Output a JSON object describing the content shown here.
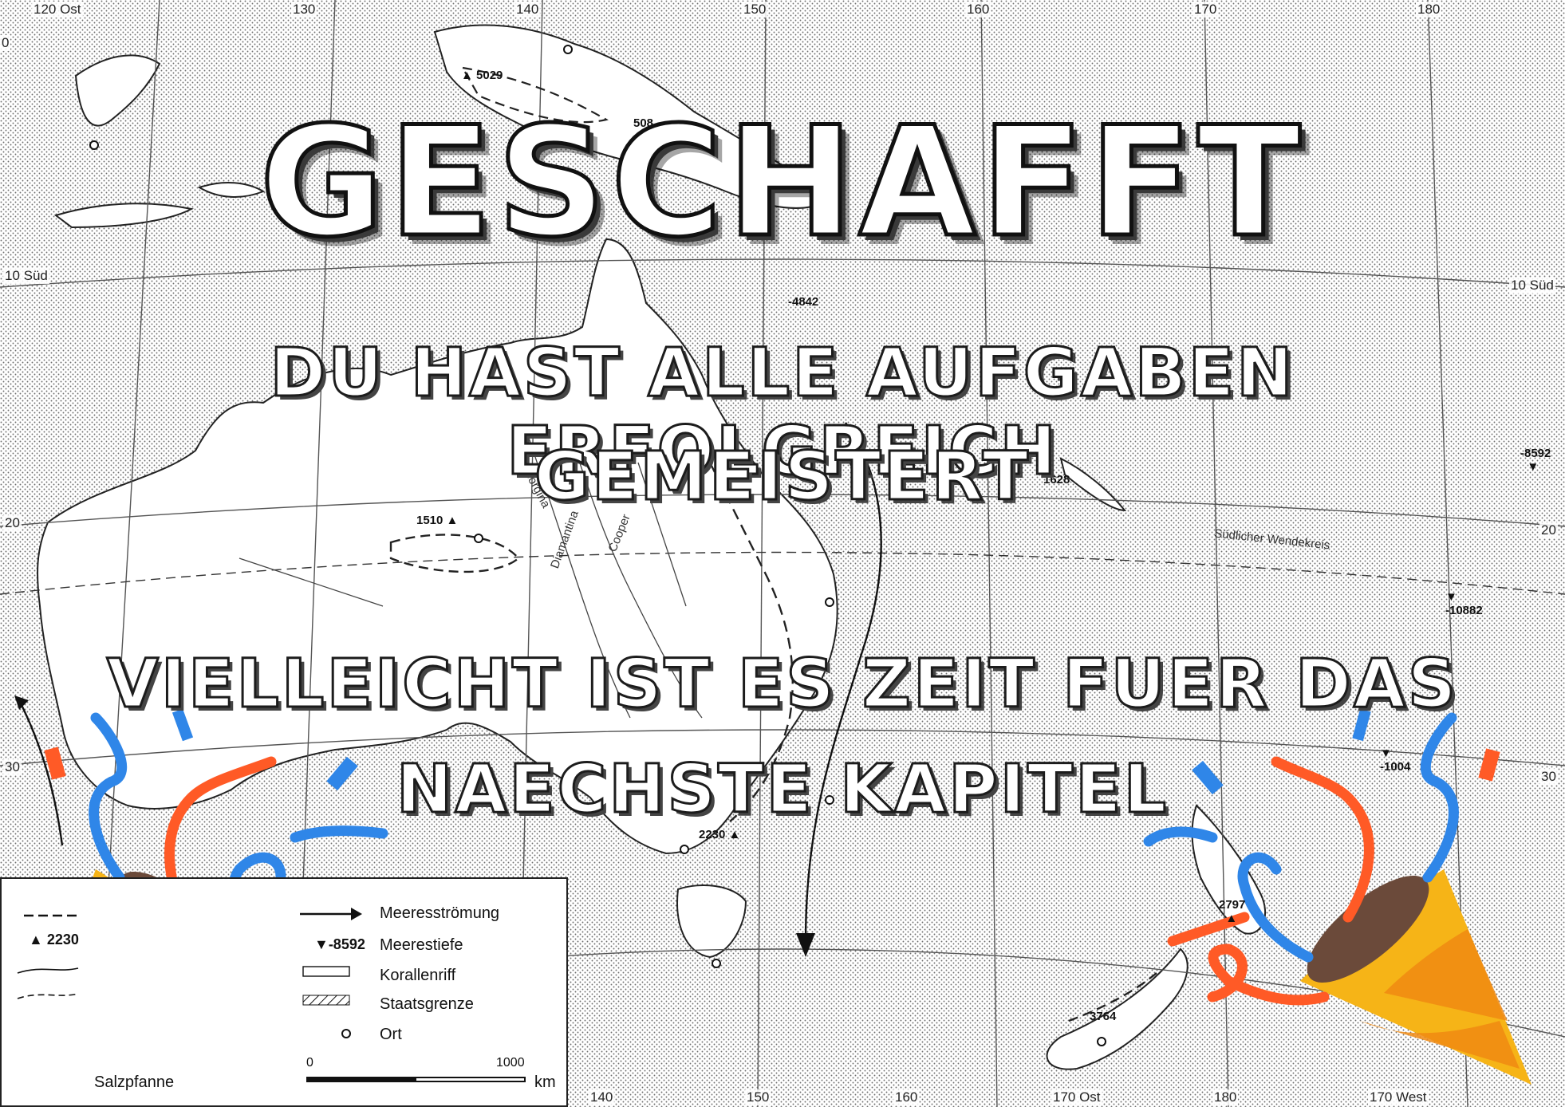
{
  "overlay": {
    "headline": "GESCHAFFT",
    "line1": "DU HAST ALLE AUFGABEN ERFOLGREICH",
    "line2": "GEMEISTERT",
    "line3": "VIELLEICHT IST ES ZEIT FUER DAS",
    "line4": "NAECHSTE KAPITEL"
  },
  "grid_labels": {
    "top": [
      "120 Ost",
      "130",
      "140",
      "150",
      "160",
      "170",
      "180"
    ],
    "bottom": [
      "140",
      "150",
      "160",
      "170 Ost",
      "180",
      "170 West"
    ],
    "left": [
      "0",
      "10 Süd",
      "20",
      "30"
    ],
    "right": [
      "10 Süd",
      "20",
      "30"
    ]
  },
  "map_labels": {
    "elevations": [
      "5029",
      "508",
      "4842",
      "1510",
      "1628",
      "2230",
      "2797",
      "3764"
    ],
    "depths": [
      "-8592",
      "-10882",
      "-1004"
    ],
    "rivers": [
      "Georgina",
      "Diamantina",
      "Cooper"
    ],
    "tropic": "Südlicher Wendekreis"
  },
  "legend": {
    "items": [
      {
        "symbol": "",
        "label": "Meeresströmung"
      },
      {
        "symbol": "▼-8592",
        "label": "Meerestiefe"
      },
      {
        "symbol": "",
        "label": "Korallenriff"
      },
      {
        "symbol": "",
        "label": "Staatsgrenze"
      },
      {
        "symbol": "○",
        "label": "Ort"
      }
    ],
    "left_symbol": "▲ 2230",
    "salt_pan": "Salzpfanne",
    "scale_start": "0",
    "scale_end": "1000",
    "scale_unit": "km"
  },
  "colors": {
    "confetti_blue": "#2f86e8",
    "confetti_orange": "#ff5a26",
    "cone_yellow": "#f6b417",
    "cone_orange": "#f08a12",
    "cone_mouth": "#6b4a3a"
  },
  "icons": [
    "party-popper-icon",
    "party-popper-icon"
  ]
}
